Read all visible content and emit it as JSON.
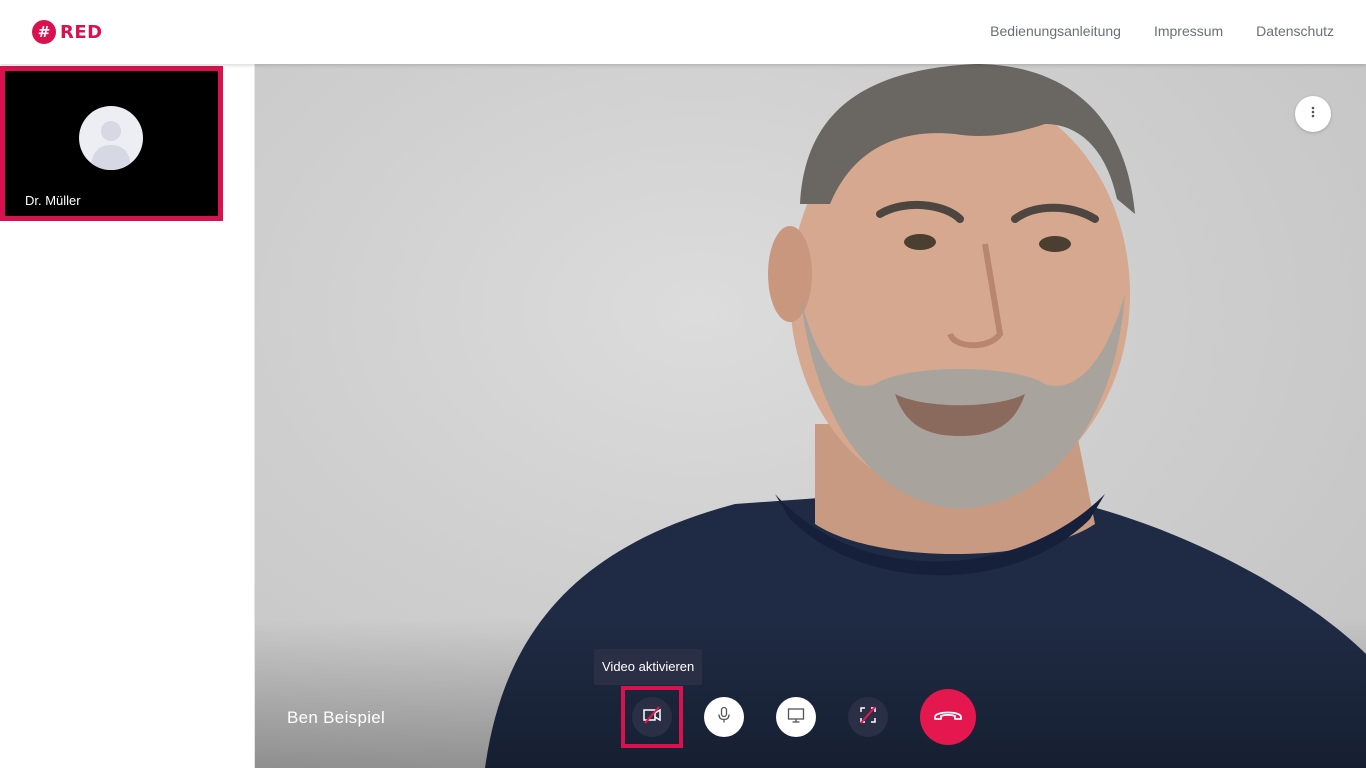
{
  "header": {
    "logo_symbol": "#",
    "logo_text": "RED",
    "brand_color": "#d9124f",
    "nav": [
      {
        "label": "Bedienungsanleitung"
      },
      {
        "label": "Impressum"
      },
      {
        "label": "Datenschutz"
      }
    ]
  },
  "sidebar": {
    "participant": {
      "name": "Dr. Müller",
      "avatar_icon": "user-avatar-icon"
    }
  },
  "stage": {
    "caller_name": "Ben Beispiel",
    "more_icon": "more-vertical-icon"
  },
  "controls": {
    "tooltip": "Video aktivieren",
    "buttons": [
      {
        "icon": "camera-off-icon",
        "state": "off"
      },
      {
        "icon": "microphone-icon",
        "state": "on"
      },
      {
        "icon": "screen-share-icon",
        "state": "on"
      },
      {
        "icon": "fullscreen-off-icon",
        "state": "off"
      },
      {
        "icon": "hang-up-icon",
        "color": "#e4174f"
      }
    ]
  }
}
